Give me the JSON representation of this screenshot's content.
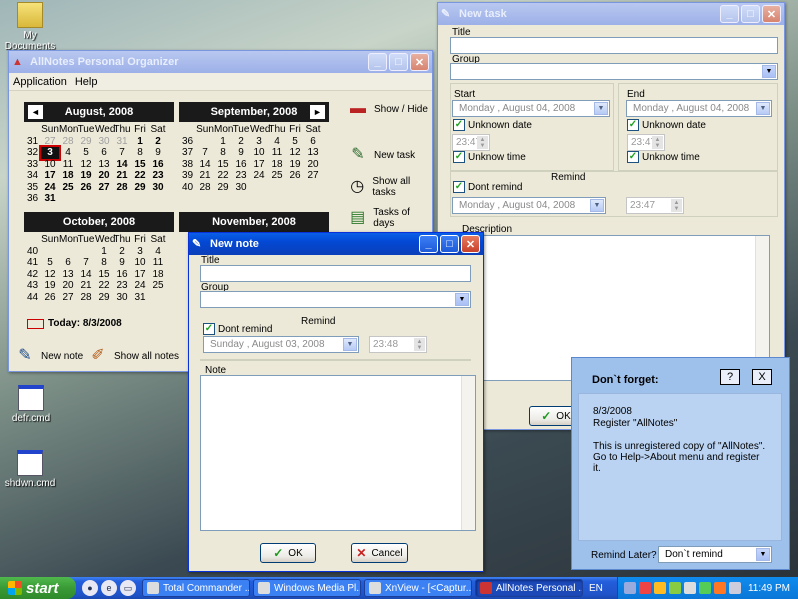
{
  "desktop": {
    "icons": [
      {
        "label": "My Documents"
      },
      {
        "label": "defr.cmd"
      },
      {
        "label": "shdwn.cmd"
      }
    ]
  },
  "organizer": {
    "title": "AllNotes Personal Organizer",
    "menu": [
      "Application",
      "Help"
    ],
    "calendars": [
      {
        "month": "August, 2008",
        "days": [
          "Sun",
          "Mon",
          "Tue",
          "Wed",
          "Thu",
          "Fri",
          "Sat"
        ],
        "weeks": [
          {
            "w": "31",
            "d": [
              "27",
              "28",
              "29",
              "30",
              "31",
              "1",
              "2"
            ]
          },
          {
            "w": "32",
            "d": [
              "3",
              "4",
              "5",
              "6",
              "7",
              "8",
              "9"
            ]
          },
          {
            "w": "33",
            "d": [
              "10",
              "11",
              "12",
              "13",
              "14",
              "15",
              "16"
            ]
          },
          {
            "w": "34",
            "d": [
              "17",
              "18",
              "19",
              "20",
              "21",
              "22",
              "23"
            ]
          },
          {
            "w": "35",
            "d": [
              "24",
              "25",
              "26",
              "27",
              "28",
              "29",
              "30"
            ]
          },
          {
            "w": "36",
            "d": [
              "31",
              "",
              "",
              "",
              "",
              "",
              ""
            ]
          }
        ]
      },
      {
        "month": "September, 2008",
        "days": [
          "Sun",
          "Mon",
          "Tue",
          "Wed",
          "Thu",
          "Fri",
          "Sat"
        ],
        "weeks": [
          {
            "w": "36",
            "d": [
              "",
              "1",
              "2",
              "3",
              "4",
              "5",
              "6"
            ]
          },
          {
            "w": "37",
            "d": [
              "7",
              "8",
              "9",
              "10",
              "11",
              "12",
              "13"
            ]
          },
          {
            "w": "38",
            "d": [
              "14",
              "15",
              "16",
              "17",
              "18",
              "19",
              "20"
            ]
          },
          {
            "w": "39",
            "d": [
              "21",
              "22",
              "23",
              "24",
              "25",
              "26",
              "27"
            ]
          },
          {
            "w": "40",
            "d": [
              "28",
              "29",
              "30",
              "",
              "",
              "",
              ""
            ]
          }
        ]
      },
      {
        "month": "October, 2008",
        "days": [
          "Sun",
          "Mon",
          "Tue",
          "Wed",
          "Thu",
          "Fri",
          "Sat"
        ],
        "weeks": [
          {
            "w": "40",
            "d": [
              "",
              "",
              "",
              "1",
              "2",
              "3",
              "4"
            ]
          },
          {
            "w": "41",
            "d": [
              "5",
              "6",
              "7",
              "8",
              "9",
              "10",
              "11"
            ]
          },
          {
            "w": "42",
            "d": [
              "12",
              "13",
              "14",
              "15",
              "16",
              "17",
              "18"
            ]
          },
          {
            "w": "43",
            "d": [
              "19",
              "20",
              "21",
              "22",
              "23",
              "24",
              "25"
            ]
          },
          {
            "w": "44",
            "d": [
              "26",
              "27",
              "28",
              "29",
              "30",
              "31",
              ""
            ]
          }
        ]
      },
      {
        "month": "November, 2008"
      }
    ],
    "today_label": "Today: 8/3/2008",
    "side_buttons": [
      "Show / Hide",
      "New task",
      "Show all tasks",
      "Tasks of days"
    ],
    "bottom_buttons": [
      "New note",
      "Show all notes"
    ],
    "nav_prev": "◄",
    "nav_next": "►"
  },
  "new_task": {
    "title": "New task",
    "title_label": "Title",
    "group_label": "Group",
    "start_label": "Start",
    "end_label": "End",
    "start_date": "Monday    ,   August    04, 2008",
    "end_date": "Monday    ,   August    04, 2008",
    "unknown_date": "Unknown date",
    "start_time": "23:47",
    "end_time": "23:47",
    "unknown_time": "Unknow time",
    "remind_label": "Remind",
    "dont_remind": "Dont remind",
    "remind_date": "Monday    ,   August    04, 2008",
    "remind_time": "23:47",
    "description_label": "Description",
    "ok_label": "OK"
  },
  "new_note": {
    "title": "New note",
    "title_label": "Title",
    "group_label": "Group",
    "remind_label": "Remind",
    "dont_remind": "Dont remind",
    "remind_date": "Sunday    ,   August    03, 2008",
    "remind_time": "23:48",
    "note_label": "Note",
    "ok_label": "OK",
    "cancel_label": "Cancel"
  },
  "reminder": {
    "title": "Don`t forget:",
    "help": "?",
    "close": "X",
    "date": "8/3/2008",
    "line1": "Register \"AllNotes\"",
    "message": "This is unregistered copy of \"AllNotes\". Go to Help->About menu and register it.",
    "remind_later_label": "Remind Later?",
    "remind_later_value": "Don`t remind"
  },
  "taskbar": {
    "start": "start",
    "tasks": [
      "Total Commander ...",
      "Windows Media Pl...",
      "XnView - [<Captur...",
      "AllNotes Personal ..."
    ],
    "lang": "EN",
    "clock": "11:49 PM"
  }
}
